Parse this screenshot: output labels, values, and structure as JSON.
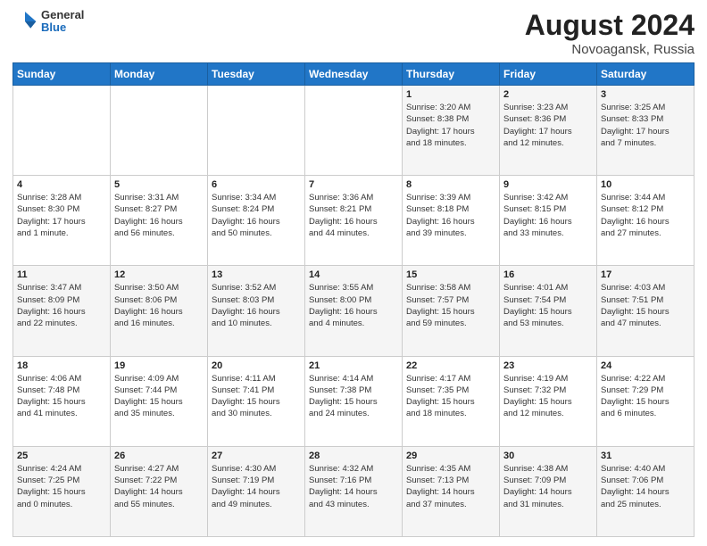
{
  "header": {
    "logo_general": "General",
    "logo_blue": "Blue",
    "month_year": "August 2024",
    "location": "Novoagansk, Russia"
  },
  "calendar": {
    "days_of_week": [
      "Sunday",
      "Monday",
      "Tuesday",
      "Wednesday",
      "Thursday",
      "Friday",
      "Saturday"
    ],
    "weeks": [
      [
        {
          "day": "",
          "info": ""
        },
        {
          "day": "",
          "info": ""
        },
        {
          "day": "",
          "info": ""
        },
        {
          "day": "",
          "info": ""
        },
        {
          "day": "1",
          "info": "Sunrise: 3:20 AM\nSunset: 8:38 PM\nDaylight: 17 hours\nand 18 minutes."
        },
        {
          "day": "2",
          "info": "Sunrise: 3:23 AM\nSunset: 8:36 PM\nDaylight: 17 hours\nand 12 minutes."
        },
        {
          "day": "3",
          "info": "Sunrise: 3:25 AM\nSunset: 8:33 PM\nDaylight: 17 hours\nand 7 minutes."
        }
      ],
      [
        {
          "day": "4",
          "info": "Sunrise: 3:28 AM\nSunset: 8:30 PM\nDaylight: 17 hours\nand 1 minute."
        },
        {
          "day": "5",
          "info": "Sunrise: 3:31 AM\nSunset: 8:27 PM\nDaylight: 16 hours\nand 56 minutes."
        },
        {
          "day": "6",
          "info": "Sunrise: 3:34 AM\nSunset: 8:24 PM\nDaylight: 16 hours\nand 50 minutes."
        },
        {
          "day": "7",
          "info": "Sunrise: 3:36 AM\nSunset: 8:21 PM\nDaylight: 16 hours\nand 44 minutes."
        },
        {
          "day": "8",
          "info": "Sunrise: 3:39 AM\nSunset: 8:18 PM\nDaylight: 16 hours\nand 39 minutes."
        },
        {
          "day": "9",
          "info": "Sunrise: 3:42 AM\nSunset: 8:15 PM\nDaylight: 16 hours\nand 33 minutes."
        },
        {
          "day": "10",
          "info": "Sunrise: 3:44 AM\nSunset: 8:12 PM\nDaylight: 16 hours\nand 27 minutes."
        }
      ],
      [
        {
          "day": "11",
          "info": "Sunrise: 3:47 AM\nSunset: 8:09 PM\nDaylight: 16 hours\nand 22 minutes."
        },
        {
          "day": "12",
          "info": "Sunrise: 3:50 AM\nSunset: 8:06 PM\nDaylight: 16 hours\nand 16 minutes."
        },
        {
          "day": "13",
          "info": "Sunrise: 3:52 AM\nSunset: 8:03 PM\nDaylight: 16 hours\nand 10 minutes."
        },
        {
          "day": "14",
          "info": "Sunrise: 3:55 AM\nSunset: 8:00 PM\nDaylight: 16 hours\nand 4 minutes."
        },
        {
          "day": "15",
          "info": "Sunrise: 3:58 AM\nSunset: 7:57 PM\nDaylight: 15 hours\nand 59 minutes."
        },
        {
          "day": "16",
          "info": "Sunrise: 4:01 AM\nSunset: 7:54 PM\nDaylight: 15 hours\nand 53 minutes."
        },
        {
          "day": "17",
          "info": "Sunrise: 4:03 AM\nSunset: 7:51 PM\nDaylight: 15 hours\nand 47 minutes."
        }
      ],
      [
        {
          "day": "18",
          "info": "Sunrise: 4:06 AM\nSunset: 7:48 PM\nDaylight: 15 hours\nand 41 minutes."
        },
        {
          "day": "19",
          "info": "Sunrise: 4:09 AM\nSunset: 7:44 PM\nDaylight: 15 hours\nand 35 minutes."
        },
        {
          "day": "20",
          "info": "Sunrise: 4:11 AM\nSunset: 7:41 PM\nDaylight: 15 hours\nand 30 minutes."
        },
        {
          "day": "21",
          "info": "Sunrise: 4:14 AM\nSunset: 7:38 PM\nDaylight: 15 hours\nand 24 minutes."
        },
        {
          "day": "22",
          "info": "Sunrise: 4:17 AM\nSunset: 7:35 PM\nDaylight: 15 hours\nand 18 minutes."
        },
        {
          "day": "23",
          "info": "Sunrise: 4:19 AM\nSunset: 7:32 PM\nDaylight: 15 hours\nand 12 minutes."
        },
        {
          "day": "24",
          "info": "Sunrise: 4:22 AM\nSunset: 7:29 PM\nDaylight: 15 hours\nand 6 minutes."
        }
      ],
      [
        {
          "day": "25",
          "info": "Sunrise: 4:24 AM\nSunset: 7:25 PM\nDaylight: 15 hours\nand 0 minutes."
        },
        {
          "day": "26",
          "info": "Sunrise: 4:27 AM\nSunset: 7:22 PM\nDaylight: 14 hours\nand 55 minutes."
        },
        {
          "day": "27",
          "info": "Sunrise: 4:30 AM\nSunset: 7:19 PM\nDaylight: 14 hours\nand 49 minutes."
        },
        {
          "day": "28",
          "info": "Sunrise: 4:32 AM\nSunset: 7:16 PM\nDaylight: 14 hours\nand 43 minutes."
        },
        {
          "day": "29",
          "info": "Sunrise: 4:35 AM\nSunset: 7:13 PM\nDaylight: 14 hours\nand 37 minutes."
        },
        {
          "day": "30",
          "info": "Sunrise: 4:38 AM\nSunset: 7:09 PM\nDaylight: 14 hours\nand 31 minutes."
        },
        {
          "day": "31",
          "info": "Sunrise: 4:40 AM\nSunset: 7:06 PM\nDaylight: 14 hours\nand 25 minutes."
        }
      ]
    ]
  }
}
